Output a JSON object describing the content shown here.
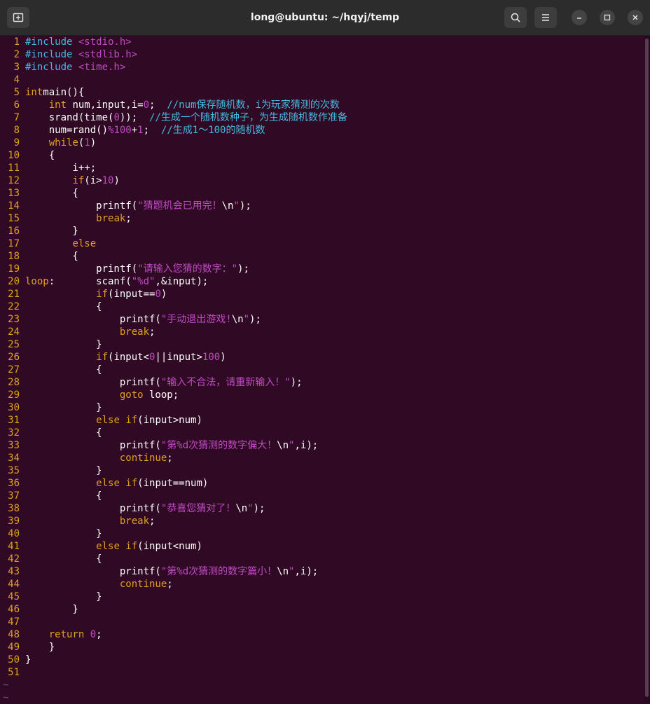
{
  "window": {
    "title": "long@ubuntu: ~/hqyj/temp"
  },
  "code_lines": [
    {
      "n": "1",
      "t": [
        [
          "pp",
          "#include "
        ],
        [
          "s",
          "<stdio.h>"
        ]
      ]
    },
    {
      "n": "2",
      "t": [
        [
          "pp",
          "#include "
        ],
        [
          "s",
          "<stdlib.h>"
        ]
      ]
    },
    {
      "n": "3",
      "t": [
        [
          "pp",
          "#include "
        ],
        [
          "s",
          "<time.h>"
        ]
      ]
    },
    {
      "n": "4",
      "t": []
    },
    {
      "n": "5",
      "t": [
        [
          "k",
          "int"
        ],
        [
          "",
          "main(){"
        ]
      ]
    },
    {
      "n": "6",
      "t": [
        [
          "",
          "    "
        ],
        [
          "k",
          "int"
        ],
        [
          "",
          " num,input,i="
        ],
        [
          "n",
          "0"
        ],
        [
          "",
          ";  "
        ],
        [
          "c",
          "//num保存随机数，i为玩家猜测的次数"
        ]
      ]
    },
    {
      "n": "7",
      "t": [
        [
          "",
          "    srand(time("
        ],
        [
          "n",
          "0"
        ],
        [
          "",
          "));  "
        ],
        [
          "c",
          "//生成一个随机数种子，为生成随机数作准备"
        ]
      ]
    },
    {
      "n": "8",
      "t": [
        [
          "",
          "    num=rand()"
        ],
        [
          "n",
          "%100"
        ],
        [
          "",
          "+"
        ],
        [
          "n",
          "1"
        ],
        [
          "",
          ";  "
        ],
        [
          "c",
          "//生成1～100的随机数"
        ]
      ]
    },
    {
      "n": "9",
      "t": [
        [
          "",
          "    "
        ],
        [
          "k",
          "while"
        ],
        [
          "",
          "("
        ],
        [
          "n",
          "1"
        ],
        [
          "",
          ")"
        ]
      ]
    },
    {
      "n": "10",
      "t": [
        [
          "",
          "    {"
        ]
      ]
    },
    {
      "n": "11",
      "t": [
        [
          "",
          "        i++;"
        ]
      ]
    },
    {
      "n": "12",
      "t": [
        [
          "",
          "        "
        ],
        [
          "k",
          "if"
        ],
        [
          "",
          "(i>"
        ],
        [
          "n",
          "10"
        ],
        [
          "",
          ")"
        ]
      ]
    },
    {
      "n": "13",
      "t": [
        [
          "",
          "        {"
        ]
      ]
    },
    {
      "n": "14",
      "t": [
        [
          "",
          "            printf("
        ],
        [
          "s",
          "\"猜题机会已用完！"
        ],
        [
          "",
          "\\n"
        ],
        [
          "s",
          "\""
        ],
        [
          "",
          ");"
        ]
      ]
    },
    {
      "n": "15",
      "t": [
        [
          "",
          "            "
        ],
        [
          "k",
          "break"
        ],
        [
          "",
          ";"
        ]
      ]
    },
    {
      "n": "16",
      "t": [
        [
          "",
          "        }"
        ]
      ]
    },
    {
      "n": "17",
      "t": [
        [
          "",
          "        "
        ],
        [
          "k",
          "else"
        ]
      ]
    },
    {
      "n": "18",
      "t": [
        [
          "",
          "        {"
        ]
      ]
    },
    {
      "n": "19",
      "t": [
        [
          "",
          "            printf("
        ],
        [
          "s",
          "\"请输入您猜的数字：\""
        ],
        [
          "",
          ");"
        ]
      ]
    },
    {
      "n": "20",
      "t": [
        [
          "l",
          "loop"
        ],
        [
          "",
          ":       scanf("
        ],
        [
          "s",
          "\"%d\""
        ],
        [
          "",
          ",&input);"
        ]
      ]
    },
    {
      "n": "21",
      "t": [
        [
          "",
          "            "
        ],
        [
          "k",
          "if"
        ],
        [
          "",
          "(input=="
        ],
        [
          "n",
          "0"
        ],
        [
          "",
          ")"
        ]
      ]
    },
    {
      "n": "22",
      "t": [
        [
          "",
          "            {"
        ]
      ]
    },
    {
      "n": "23",
      "t": [
        [
          "",
          "                printf("
        ],
        [
          "s",
          "\"手动退出游戏!"
        ],
        [
          "",
          "\\n"
        ],
        [
          "s",
          "\""
        ],
        [
          "",
          ");"
        ]
      ]
    },
    {
      "n": "24",
      "t": [
        [
          "",
          "                "
        ],
        [
          "k",
          "break"
        ],
        [
          "",
          ";"
        ]
      ]
    },
    {
      "n": "25",
      "t": [
        [
          "",
          "            }"
        ]
      ]
    },
    {
      "n": "26",
      "t": [
        [
          "",
          "            "
        ],
        [
          "k",
          "if"
        ],
        [
          "",
          "(input<"
        ],
        [
          "n",
          "0"
        ],
        [
          "",
          "||input>"
        ],
        [
          "n",
          "100"
        ],
        [
          "",
          ")"
        ]
      ]
    },
    {
      "n": "27",
      "t": [
        [
          "",
          "            {"
        ]
      ]
    },
    {
      "n": "28",
      "t": [
        [
          "",
          "                printf("
        ],
        [
          "s",
          "\"输入不合法，请重新输入！\""
        ],
        [
          "",
          ");"
        ]
      ]
    },
    {
      "n": "29",
      "t": [
        [
          "",
          "                "
        ],
        [
          "k",
          "goto"
        ],
        [
          "",
          " loop;"
        ]
      ]
    },
    {
      "n": "30",
      "t": [
        [
          "",
          "            }"
        ]
      ]
    },
    {
      "n": "31",
      "t": [
        [
          "",
          "            "
        ],
        [
          "k",
          "else if"
        ],
        [
          "",
          "(input>num)"
        ]
      ]
    },
    {
      "n": "32",
      "t": [
        [
          "",
          "            {"
        ]
      ]
    },
    {
      "n": "33",
      "t": [
        [
          "",
          "                printf("
        ],
        [
          "s",
          "\"第%d次猜测的数字偏大！"
        ],
        [
          "",
          "\\n"
        ],
        [
          "s",
          "\""
        ],
        [
          "",
          ",i);"
        ]
      ]
    },
    {
      "n": "34",
      "t": [
        [
          "",
          "                "
        ],
        [
          "k",
          "continue"
        ],
        [
          "",
          ";"
        ]
      ]
    },
    {
      "n": "35",
      "t": [
        [
          "",
          "            }"
        ]
      ]
    },
    {
      "n": "36",
      "t": [
        [
          "",
          "            "
        ],
        [
          "k",
          "else if"
        ],
        [
          "",
          "(input==num)"
        ]
      ]
    },
    {
      "n": "37",
      "t": [
        [
          "",
          "            {"
        ]
      ]
    },
    {
      "n": "38",
      "t": [
        [
          "",
          "                printf("
        ],
        [
          "s",
          "\"恭喜您猜对了！"
        ],
        [
          "",
          "\\n"
        ],
        [
          "s",
          "\""
        ],
        [
          "",
          ");"
        ]
      ]
    },
    {
      "n": "39",
      "t": [
        [
          "",
          "                "
        ],
        [
          "k",
          "break"
        ],
        [
          "",
          ";"
        ]
      ]
    },
    {
      "n": "40",
      "t": [
        [
          "",
          "            }"
        ]
      ]
    },
    {
      "n": "41",
      "t": [
        [
          "",
          "            "
        ],
        [
          "k",
          "else if"
        ],
        [
          "",
          "(input<num)"
        ]
      ]
    },
    {
      "n": "42",
      "t": [
        [
          "",
          "            {"
        ]
      ]
    },
    {
      "n": "43",
      "t": [
        [
          "",
          "                printf("
        ],
        [
          "s",
          "\"第%d次猜测的数字篇小！"
        ],
        [
          "",
          "\\n"
        ],
        [
          "s",
          "\""
        ],
        [
          "",
          ",i);"
        ]
      ]
    },
    {
      "n": "44",
      "t": [
        [
          "",
          "                "
        ],
        [
          "k",
          "continue"
        ],
        [
          "",
          ";"
        ]
      ]
    },
    {
      "n": "45",
      "t": [
        [
          "",
          "            }"
        ]
      ]
    },
    {
      "n": "46",
      "t": [
        [
          "",
          "        }"
        ]
      ]
    },
    {
      "n": "47",
      "t": []
    },
    {
      "n": "48",
      "t": [
        [
          "",
          "    "
        ],
        [
          "k",
          "return"
        ],
        [
          "",
          ""
        ],
        [
          "n",
          " 0"
        ],
        [
          "",
          ";"
        ]
      ]
    },
    {
      "n": "49",
      "t": [
        [
          "",
          "    }"
        ]
      ]
    },
    {
      "n": "50",
      "t": [
        [
          "",
          "}"
        ]
      ]
    },
    {
      "n": "51",
      "t": []
    }
  ],
  "tilde_lines": [
    "~",
    "~"
  ],
  "icons": [
    "new-tab-icon",
    "search-icon",
    "hamburger-menu-icon",
    "minimize-icon",
    "maximize-icon",
    "close-icon"
  ]
}
